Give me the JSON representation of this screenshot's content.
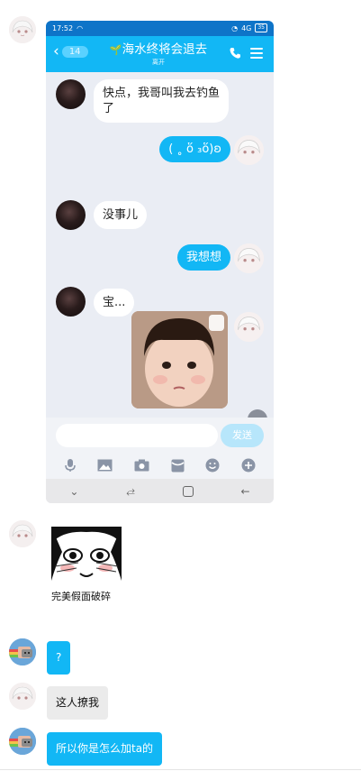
{
  "phone": {
    "status_time": "17:52",
    "status_right": "4G",
    "battery": "35",
    "back_badge": "14",
    "group_title": "海水终将会退去",
    "group_subtitle": "离开",
    "input_send": "发送",
    "messages": [
      {
        "side": "left",
        "text": "快点，我哥叫我去钓鱼了"
      },
      {
        "side": "right",
        "text": "( ˳ ὅ ₃ὅ)ʚ"
      },
      {
        "side": "left",
        "text": "没事儿"
      },
      {
        "side": "right",
        "text": "我想想"
      },
      {
        "side": "left",
        "text": "宝..."
      }
    ]
  },
  "meme": {
    "caption": "完美假面破碎"
  },
  "conversation": [
    {
      "side": "left",
      "avatar": "nyan",
      "style": "blue",
      "text": "?"
    },
    {
      "side": "left",
      "avatar": "girl",
      "style": "gray",
      "text": "这人撩我"
    },
    {
      "side": "left",
      "avatar": "nyan",
      "style": "blue",
      "text": "所以你是怎么加ta的"
    }
  ],
  "colors": {
    "accent": "#12b7f5",
    "header": "#12b7f5",
    "statusbar": "#0e74c8"
  }
}
